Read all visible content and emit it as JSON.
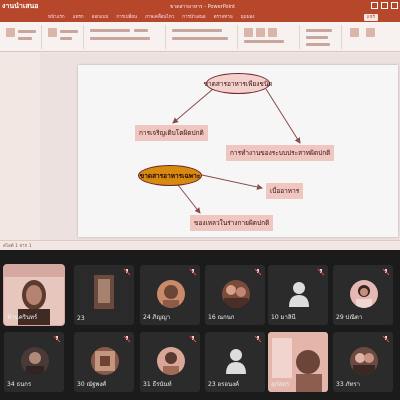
{
  "ppt": {
    "app_title": "งานนำเสนอ",
    "doc_title": "ขาดสารอาหาร - PowerPoint",
    "tabs": [
      "หน้าแรก",
      "แทรก",
      "ออกแบบ",
      "การเปลี่ยน",
      "ภาพเคลื่อนไหว",
      "การนำเสนอ",
      "ตรวจทาน",
      "มุมมอง"
    ],
    "share_label": "แชร์",
    "status_text": "สไลด์ 1 จาก 1",
    "accent": "#b7472a"
  },
  "slide": {
    "oval_top": "ขาดสารอาหารเพียงชนิด",
    "box_left": "การเจริญเติบโตผิดปกติ",
    "box_right": "การทำงานของระบบประสาทผิดปกติ",
    "oval_bottom": "ขาดสารอาหารเฉพาะ",
    "box_food": "เบื่ออาหาร",
    "box_bottom": "ของเหลวในร่างกายผิดปกติ"
  },
  "gallery": {
    "row1": [
      "ฟ้านครินทร์",
      "23",
      "24 ภิญญา",
      "16 ณกนก",
      "10 มาลินี",
      "29 ปณิตา"
    ],
    "row2": [
      "34 ธนกร",
      "30 ณัฐพงศ์",
      "31 ธีรนันท์",
      "23 อรอนงค์",
      "สุภัสสร",
      "33 ภัทรา"
    ]
  }
}
